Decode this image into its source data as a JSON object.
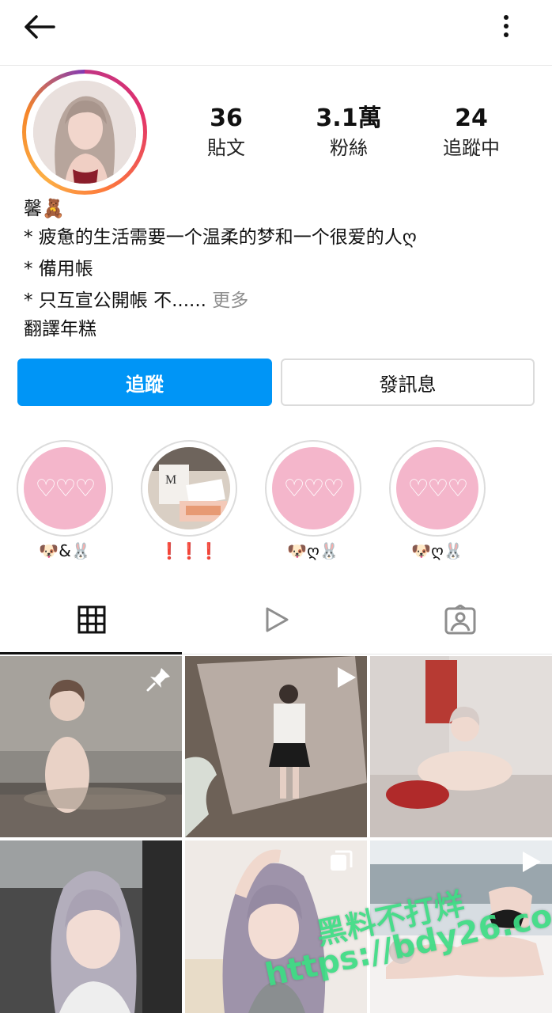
{
  "header": {
    "back_icon": "arrow-left-icon",
    "more_icon": "vertical-dots-icon"
  },
  "profile": {
    "stats": [
      {
        "value": "36",
        "label": "貼文"
      },
      {
        "value": "3.1萬",
        "label": "粉絲"
      },
      {
        "value": "24",
        "label": "追蹤中"
      }
    ],
    "bio": {
      "name": "馨🧸",
      "line1": "* 疲惫的生活需要一个温柔的梦和一个很爱的人ღ",
      "line2": "* 備用帳",
      "line3": "* 只互宣公開帳 不......",
      "more": " 更多",
      "translate": "翻譯年糕"
    }
  },
  "actions": {
    "follow": "追蹤",
    "message": "發訊息"
  },
  "highlights": [
    {
      "label": "🐶&🐰",
      "cover": "pink-hearts"
    },
    {
      "label": "❗❗❗",
      "cover": "photo"
    },
    {
      "label": "🐶ღ🐰",
      "cover": "pink-hearts"
    },
    {
      "label": "🐶ღ🐰",
      "cover": "pink-hearts"
    }
  ],
  "highlight_cover_text": "♡♡♡",
  "tabs": [
    {
      "name": "posts",
      "icon": "grid-icon",
      "active": true
    },
    {
      "name": "reels",
      "icon": "play-icon",
      "active": false
    },
    {
      "name": "tagged",
      "icon": "tagged-person-icon",
      "active": false
    }
  ],
  "posts": [
    {
      "badge": "pin-icon"
    },
    {
      "badge": "reel-play-icon"
    },
    {
      "badge": ""
    },
    {
      "badge": ""
    },
    {
      "badge": "carousel-icon"
    },
    {
      "badge": "reel-play-icon"
    }
  ],
  "watermark": {
    "line1": "黑料不打烊",
    "line2": "https://bdy26.co"
  },
  "colors": {
    "primary": "#0095f6",
    "highlight_pink": "#f4b6cb"
  }
}
